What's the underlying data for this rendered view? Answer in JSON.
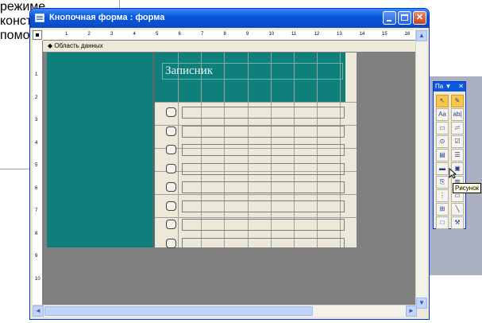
{
  "background": {
    "doc_lines": [
      "режиме конструктора",
      "помощь"
    ]
  },
  "window": {
    "title": "Кнопочная форма : форма",
    "section_header": "Область данных",
    "section_arrow": "◆",
    "min_icon": "minimize-icon",
    "max_icon": "maximize-icon",
    "close_icon": "close-icon",
    "close_glyph": "✕"
  },
  "ruler": {
    "h_marks": [
      "1",
      "2",
      "3",
      "4",
      "5",
      "6",
      "7",
      "8",
      "9",
      "10",
      "11",
      "12",
      "13",
      "14",
      "15",
      "16"
    ],
    "v_marks": [
      "1",
      "2",
      "3",
      "4",
      "5",
      "6",
      "7",
      "8",
      "9",
      "10"
    ]
  },
  "form": {
    "title_label": "Записник",
    "row_count": 8,
    "colors": {
      "teal": "#0f7f7c",
      "canvas": "#ece9d8",
      "dark": "#808080"
    }
  },
  "toolbox": {
    "title": "Па",
    "menu_glyph": "▼",
    "close_glyph": "✕",
    "tools": [
      {
        "icon": "select-pointer-icon",
        "glyph": "↖"
      },
      {
        "icon": "wizard-icon",
        "glyph": "✎"
      },
      {
        "icon": "label-icon",
        "glyph": "Aa"
      },
      {
        "icon": "textbox-icon",
        "glyph": "ab|"
      },
      {
        "icon": "option-group-icon",
        "glyph": "▭"
      },
      {
        "icon": "toggle-button-icon",
        "glyph": "≓"
      },
      {
        "icon": "option-button-icon",
        "glyph": "⊙"
      },
      {
        "icon": "checkbox-icon",
        "glyph": "☑"
      },
      {
        "icon": "combo-box-icon",
        "glyph": "▤"
      },
      {
        "icon": "list-box-icon",
        "glyph": "☰"
      },
      {
        "icon": "command-button-icon",
        "glyph": "▬"
      },
      {
        "icon": "image-icon",
        "glyph": "▣"
      },
      {
        "icon": "unbound-object-icon",
        "glyph": "⎘"
      },
      {
        "icon": "bound-object-icon",
        "glyph": "▥"
      },
      {
        "icon": "page-break-icon",
        "glyph": "⋮"
      },
      {
        "icon": "tab-control-icon",
        "glyph": "▭"
      },
      {
        "icon": "subform-icon",
        "glyph": "⊞"
      },
      {
        "icon": "line-icon",
        "glyph": "╲"
      },
      {
        "icon": "rectangle-icon",
        "glyph": "□"
      },
      {
        "icon": "more-controls-icon",
        "glyph": "⚒"
      }
    ],
    "tooltip": "Рисунок"
  },
  "scroll": {
    "up": "▲",
    "down": "▼",
    "left": "◄",
    "right": "►",
    "grip": "⁞"
  }
}
